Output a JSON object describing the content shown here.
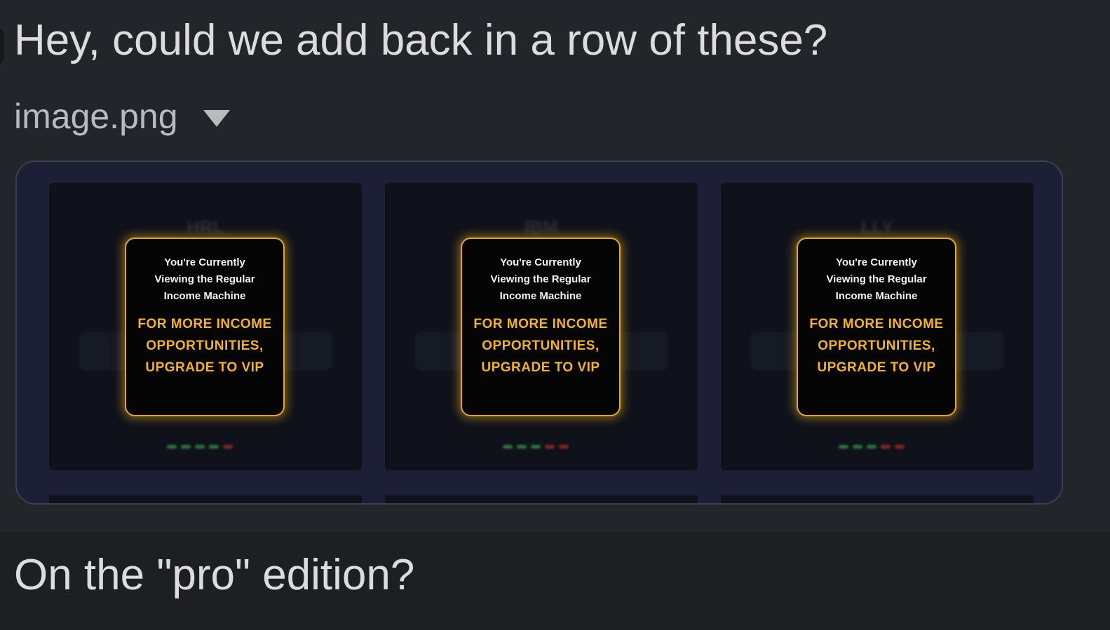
{
  "messages": [
    {
      "text": "Hey, could we add back in a row of these?",
      "attachment": {
        "file_name": "image.png",
        "toggle_icon": "caret-down-icon",
        "panels": [
          {
            "ticker": "HRL",
            "card_intro": "You're Currently Viewing the Regular Income Machine",
            "card_cta": "FOR MORE INCOME OPPORTUNITIES, UPGRADE TO VIP",
            "dot_colors": [
              "#2f7d43",
              "#2f7d43",
              "#2f7d43",
              "#2f7d43",
              "#8a2a2a"
            ]
          },
          {
            "ticker": "IBM",
            "card_intro": "You're Currently Viewing the Regular Income Machine",
            "card_cta": "FOR MORE INCOME OPPORTUNITIES, UPGRADE TO VIP",
            "dot_colors": [
              "#2f7d43",
              "#2f7d43",
              "#2f7d43",
              "#8a2a2a",
              "#8a2a2a"
            ]
          },
          {
            "ticker": "LLY",
            "card_intro": "You're Currently Viewing the Regular Income Machine",
            "card_cta": "FOR MORE INCOME OPPORTUNITIES, UPGRADE TO VIP",
            "dot_colors": [
              "#2f7d43",
              "#2f7d43",
              "#2f7d43",
              "#8a2a2a",
              "#8a2a2a"
            ]
          }
        ]
      }
    },
    {
      "text": "On the \"pro\" edition?"
    }
  ],
  "colors": {
    "background": "#1d1f23",
    "highlighted_message": "#222529",
    "card_border": "#e2a721",
    "card_cta_text": "#f2b421"
  }
}
